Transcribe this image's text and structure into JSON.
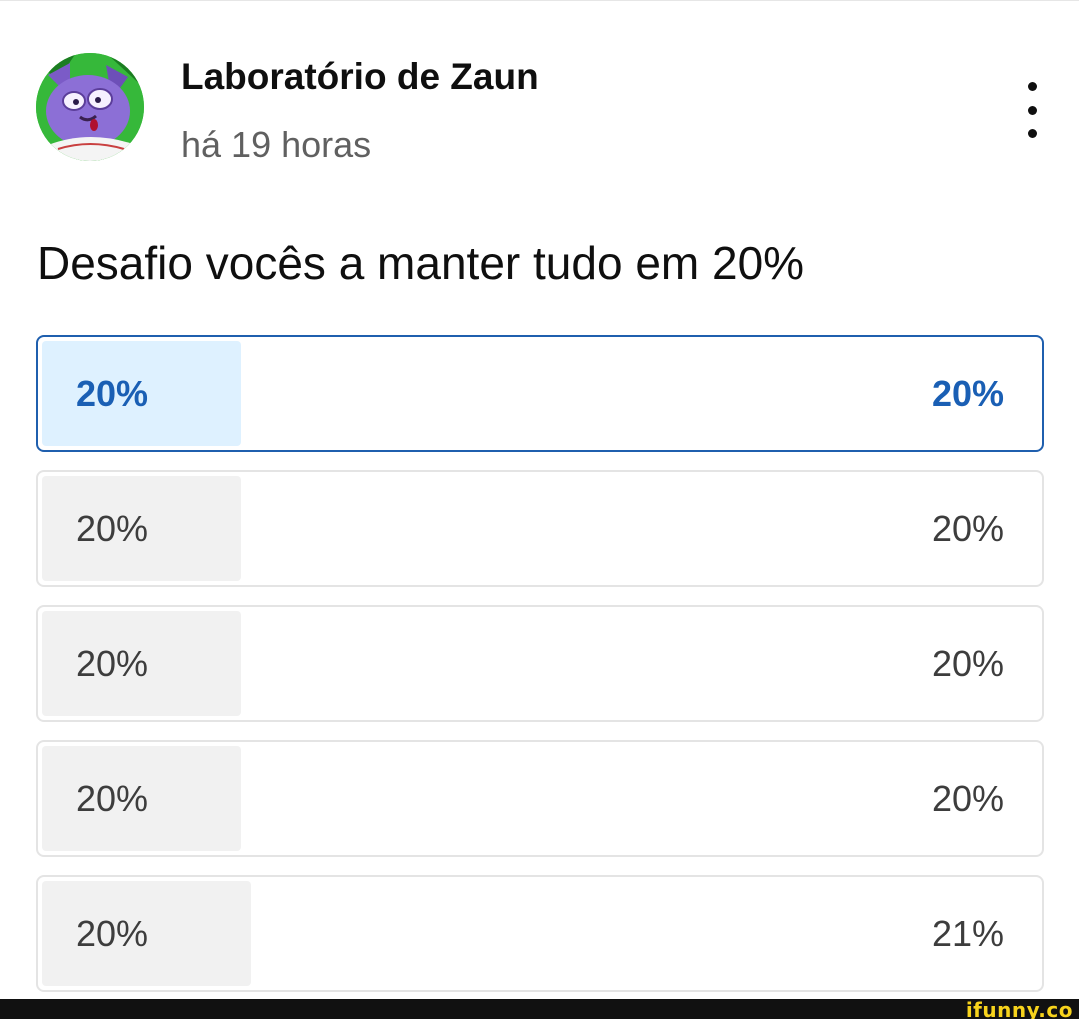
{
  "post": {
    "channel_name": "Laboratório de Zaun",
    "time": "há 19 horas",
    "question": "Desafio vocês a manter tudo em 20%"
  },
  "icons": {
    "menu": "more-vert-icon",
    "avatar": "channel-avatar"
  },
  "colors": {
    "selected_border": "#1f5fae",
    "selected_text": "#1a5fb4",
    "selected_fill": "#def1ff",
    "fill": "#f1f1f1"
  },
  "poll": {
    "options": [
      {
        "label": "20%",
        "percent": "20%",
        "value": 20,
        "selected": true
      },
      {
        "label": "20%",
        "percent": "20%",
        "value": 20,
        "selected": false
      },
      {
        "label": "20%",
        "percent": "20%",
        "value": 20,
        "selected": false
      },
      {
        "label": "20%",
        "percent": "20%",
        "value": 20,
        "selected": false
      },
      {
        "label": "20%",
        "percent": "21%",
        "value": 21,
        "selected": false
      }
    ]
  },
  "watermark": "ifunny.co"
}
